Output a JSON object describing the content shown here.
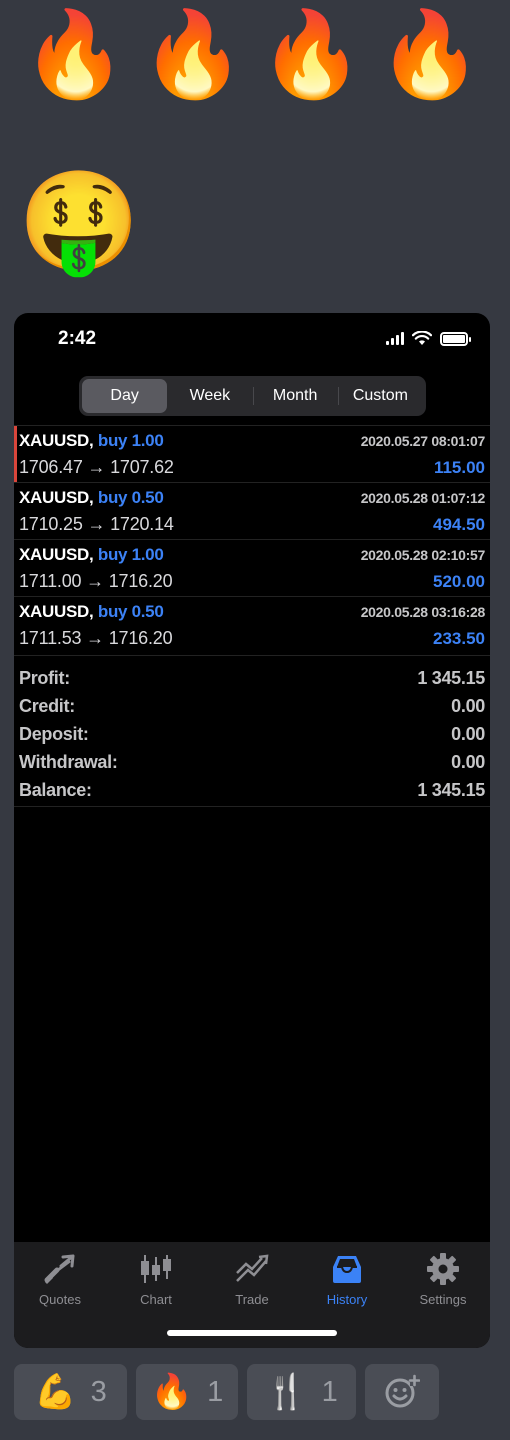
{
  "top_emojis": [
    "🔥",
    "🔥",
    "🔥",
    "🔥"
  ],
  "money_emoji": "🤑",
  "status_bar": {
    "time": "2:42"
  },
  "period_tabs": [
    {
      "label": "Day",
      "active": true
    },
    {
      "label": "Week",
      "active": false
    },
    {
      "label": "Month",
      "active": false
    },
    {
      "label": "Custom",
      "active": false
    }
  ],
  "trades": [
    {
      "symbol": "XAUUSD,",
      "side": "buy 1.00",
      "date": "2020.05.27 08:01:07",
      "prices": "1706.47 → 1707.62",
      "profit": "115.00"
    },
    {
      "symbol": "XAUUSD,",
      "side": "buy 0.50",
      "date": "2020.05.28 01:07:12",
      "prices": "1710.25 → 1720.14",
      "profit": "494.50"
    },
    {
      "symbol": "XAUUSD,",
      "side": "buy 1.00",
      "date": "2020.05.28 02:10:57",
      "prices": "1711.00 → 1716.20",
      "profit": "520.00"
    },
    {
      "symbol": "XAUUSD,",
      "side": "buy 0.50",
      "date": "2020.05.28 03:16:28",
      "prices": "1711.53 → 1716.20",
      "profit": "233.50"
    }
  ],
  "summary": [
    {
      "label": "Profit:",
      "value": "1 345.15"
    },
    {
      "label": "Credit:",
      "value": "0.00"
    },
    {
      "label": "Deposit:",
      "value": "0.00"
    },
    {
      "label": "Withdrawal:",
      "value": "0.00"
    },
    {
      "label": "Balance:",
      "value": "1 345.15"
    }
  ],
  "tabbar": [
    {
      "label": "Quotes",
      "icon": "quotes-arrows-icon",
      "active": false
    },
    {
      "label": "Chart",
      "icon": "candlestick-icon",
      "active": false
    },
    {
      "label": "Trade",
      "icon": "trend-up-icon",
      "active": false
    },
    {
      "label": "History",
      "icon": "inbox-icon",
      "active": true
    },
    {
      "label": "Settings",
      "icon": "gear-icon",
      "active": false
    }
  ],
  "reactions": [
    {
      "emoji": "💪",
      "count": "3"
    },
    {
      "emoji": "🔥",
      "count": "1"
    },
    {
      "emoji": "🍴",
      "count": "1"
    },
    {
      "emoji": "",
      "count": "",
      "icon": "add-reaction-icon"
    }
  ],
  "colors": {
    "accent": "#3c82f6",
    "background": "#363941",
    "panel": "#000000"
  }
}
